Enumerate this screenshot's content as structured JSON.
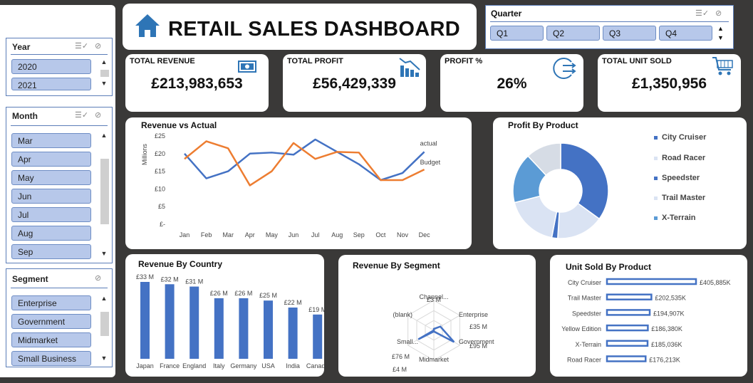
{
  "title": "RETAIL SALES DASHBOARD",
  "slicers": {
    "year": {
      "title": "Year",
      "items": [
        "2020",
        "2021"
      ]
    },
    "month": {
      "title": "Month",
      "items": [
        "Mar",
        "Apr",
        "May",
        "Jun",
        "Jul",
        "Aug",
        "Sep"
      ]
    },
    "segment": {
      "title": "Segment",
      "items": [
        "Enterprise",
        "Government",
        "Midmarket",
        "Small Business"
      ]
    },
    "quarter": {
      "title": "Quarter",
      "items": [
        "Q1",
        "Q2",
        "Q3",
        "Q4"
      ]
    }
  },
  "icons": {
    "home": "home-icon",
    "multi_select": "multi-select-icon",
    "clear_filter": "clear-filter-icon",
    "money": "money-icon",
    "bar_chart": "bar-chart-icon",
    "share": "share-arrow-icon",
    "cart": "shopping-cart-icon"
  },
  "kpis": {
    "revenue": {
      "label": "TOTAL REVENUE",
      "value": "£213,983,653"
    },
    "profit": {
      "label": "TOTAL PROFIT",
      "value": "£56,429,339"
    },
    "profit_pct": {
      "label": "PROFIT %",
      "value": "26%"
    },
    "units": {
      "label": "TOTAL UNIT SOLD",
      "value": "£1,350,956"
    }
  },
  "colors": {
    "blue": "#4472c4",
    "orange": "#ed7d31",
    "chip": "#b7c8ea",
    "light_blue": "#d6dcea",
    "mid_blue": "#5b9bd5"
  },
  "chart_data": [
    {
      "type": "line",
      "title": "Revenue vs Actual",
      "ylabel": "Millions",
      "x": [
        "Jan",
        "Feb",
        "Mar",
        "Apr",
        "May",
        "Jun",
        "Jul",
        "Aug",
        "Sep",
        "Oct",
        "Nov",
        "Dec"
      ],
      "y_ticks": [
        "£-",
        "£5",
        "£10",
        "£15",
        "£20",
        "£25"
      ],
      "ylim": [
        0,
        25
      ],
      "series": [
        {
          "name": "actual",
          "values": [
            20,
            13,
            15,
            20,
            20.3,
            19.7,
            24,
            20.5,
            17,
            12.5,
            14.5,
            20.5
          ]
        },
        {
          "name": "Budget",
          "values": [
            18.5,
            23.5,
            21.5,
            11,
            15,
            23,
            18.5,
            20.5,
            20.3,
            12.5,
            12.5,
            15.5
          ]
        }
      ]
    },
    {
      "type": "pie",
      "title": "Profit By Product",
      "categories": [
        "City Cruiser",
        "Road Racer",
        "Speedster",
        "Trail Master",
        "X-Terrain"
      ],
      "values": [
        35,
        16,
        2,
        18,
        17,
        12
      ],
      "slice_colors": [
        "#4472c4",
        "#dae3f3",
        "#4472c4",
        "#dae3f3",
        "#5b9bd5",
        "#d6dce5"
      ]
    },
    {
      "type": "bar",
      "title": "Revenue By Country",
      "categories": [
        "Japan",
        "France",
        "England",
        "Italy",
        "Germany",
        "USA",
        "India",
        "Canada"
      ],
      "values": [
        33,
        32,
        31,
        26,
        26,
        25,
        22,
        19
      ],
      "labels": [
        "£33 M",
        "£32 M",
        "£31 M",
        "£26 M",
        "£26 M",
        "£25 M",
        "£22 M",
        "£19 M"
      ]
    },
    {
      "type": "radar",
      "title": "Revenue By Segment",
      "categories": [
        "Channel...",
        "Enterprise",
        "Government",
        "Midmarket",
        "Small...",
        "(blank)"
      ],
      "value_labels": [
        "£3 M",
        "£35 M",
        "£95 M",
        "£4 M",
        "£76 M"
      ]
    },
    {
      "type": "bar",
      "title": "Unit Sold By Product",
      "categories": [
        "City Cruiser",
        "Trail Master",
        "Speedster",
        "Yellow Edition",
        "X-Terrain",
        "Road Racer"
      ],
      "values": [
        405885,
        202535,
        194907,
        186380,
        185036,
        176213
      ],
      "labels": [
        "£405,885K",
        "£202,535K",
        "£194,907K",
        "£186,380K",
        "£185,036K",
        "£176,213K"
      ]
    }
  ]
}
